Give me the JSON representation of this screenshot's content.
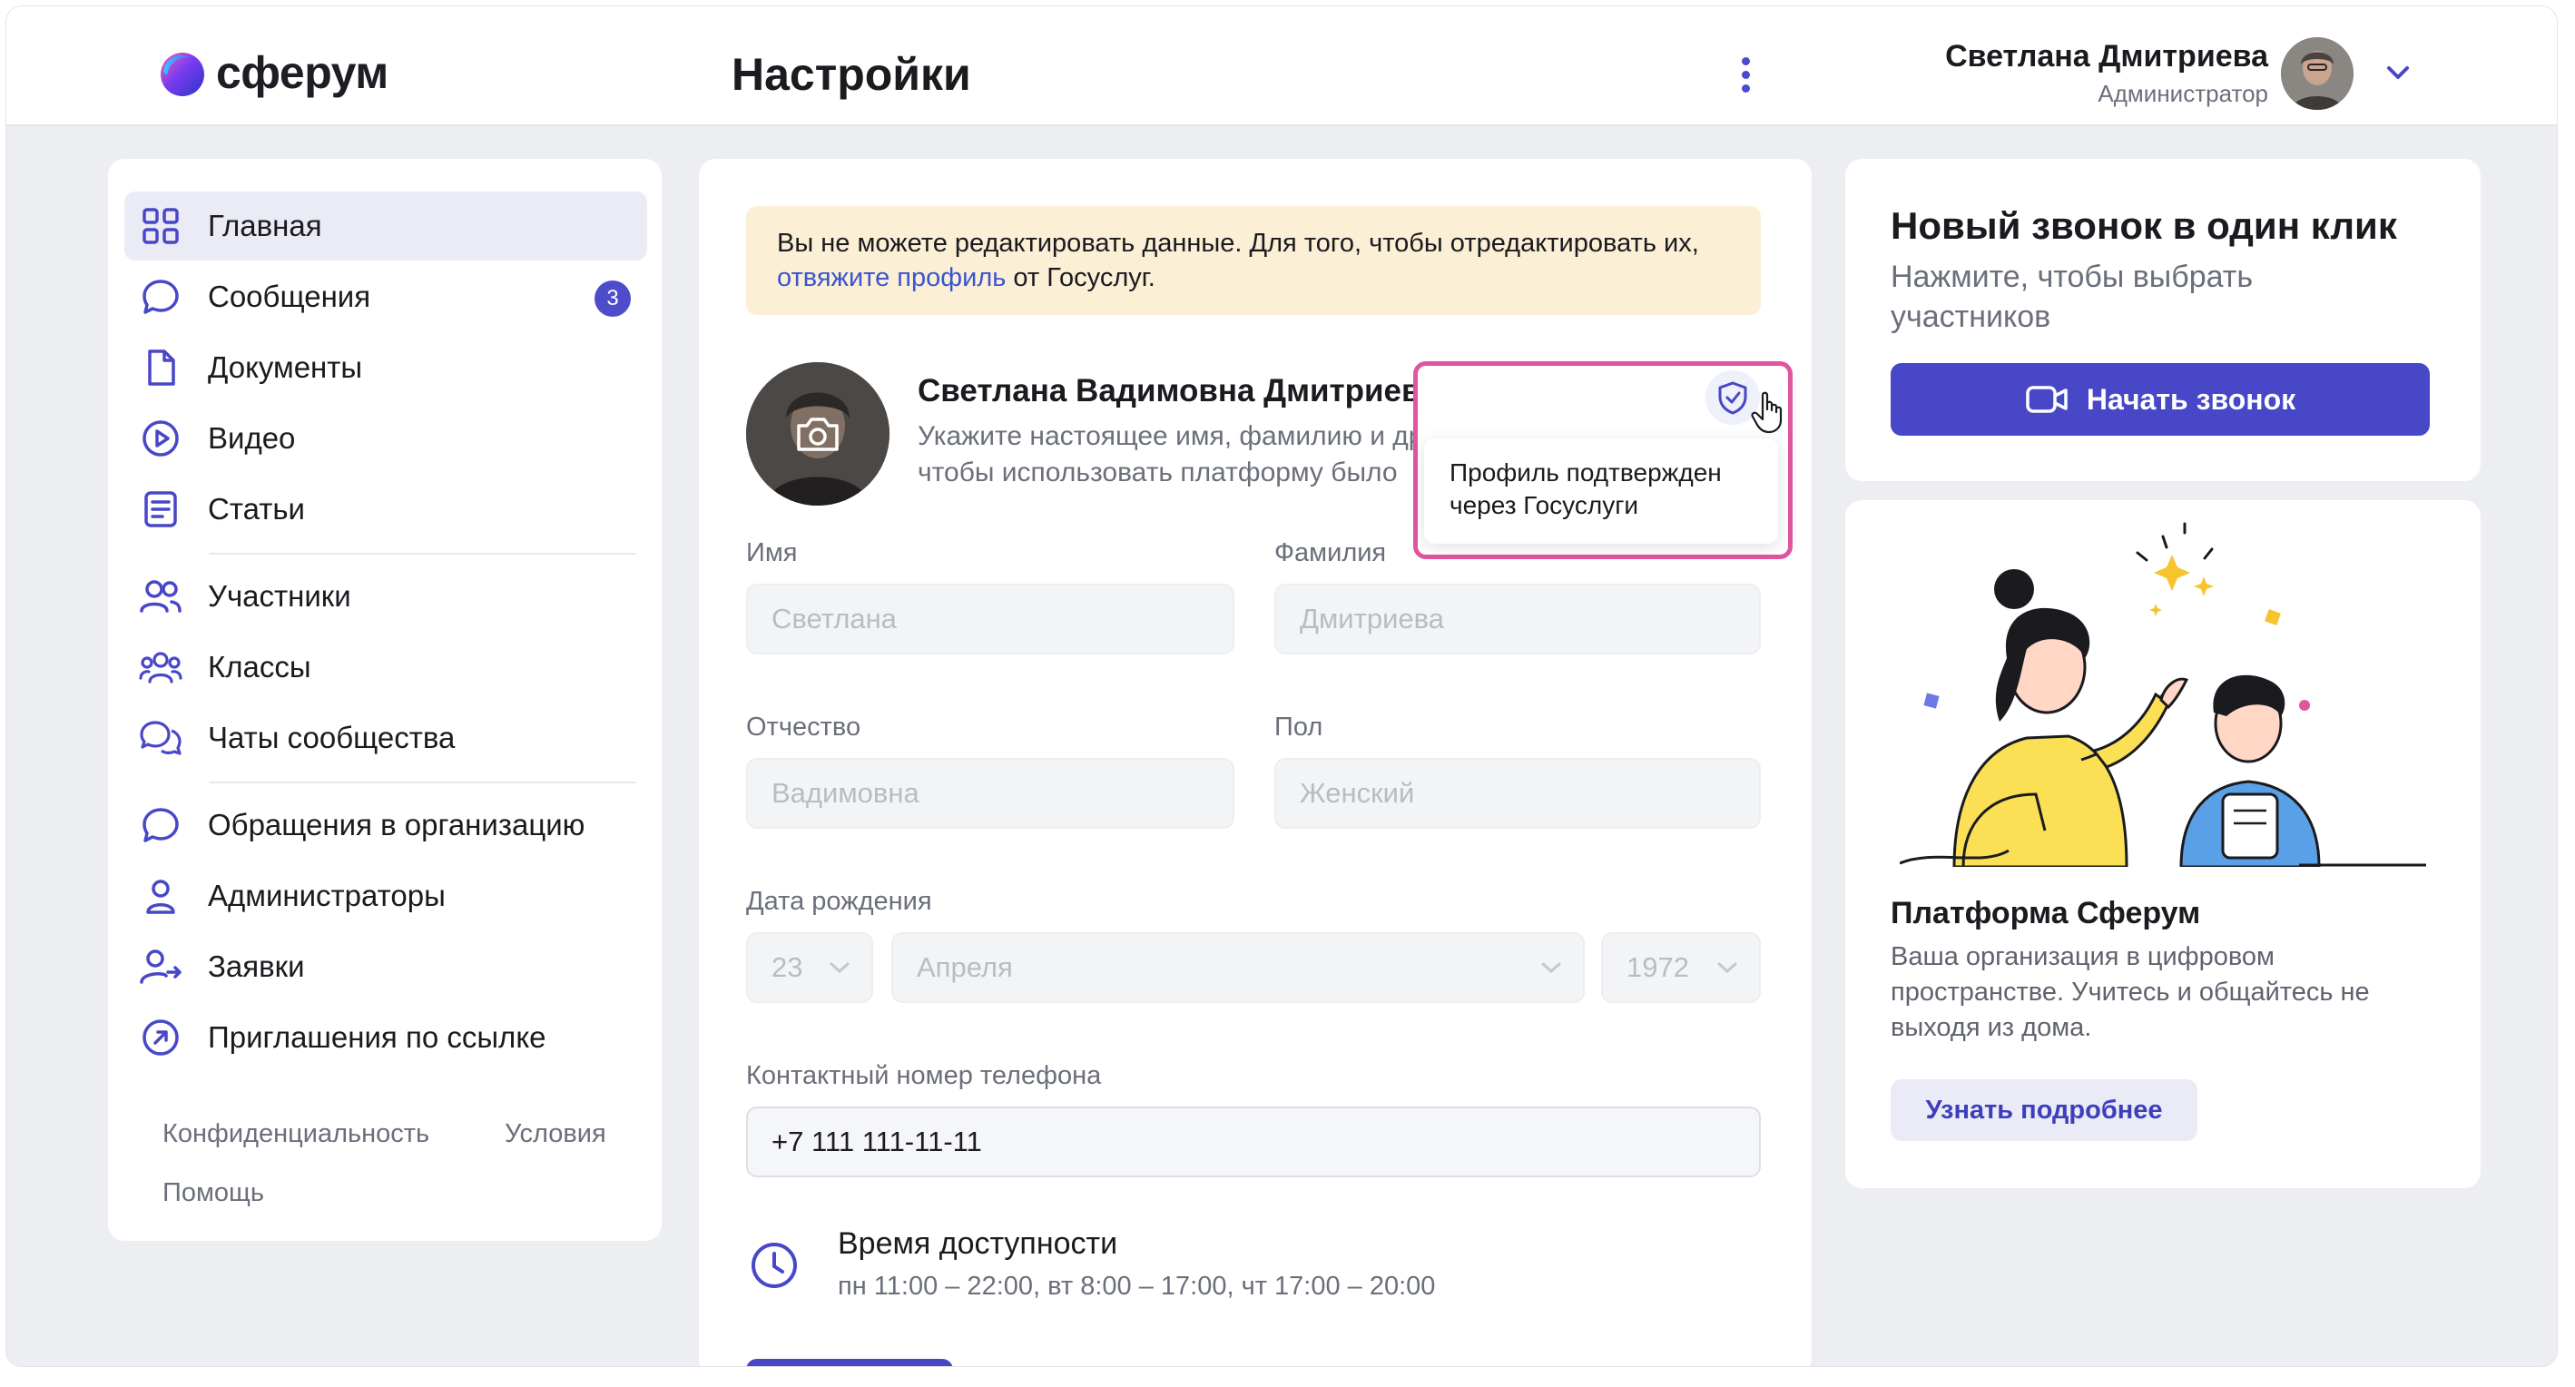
{
  "app": {
    "brand": "сферум",
    "page_title": "Настройки",
    "accent_color": "#4747c8"
  },
  "user": {
    "name": "Светлана Дмитриева",
    "role": "Администратор"
  },
  "sidebar": {
    "items": [
      {
        "label": "Главная",
        "icon": "grid-icon",
        "active": true
      },
      {
        "label": "Сообщения",
        "icon": "chat-bubble-icon",
        "badge": "3"
      },
      {
        "label": "Документы",
        "icon": "document-icon"
      },
      {
        "label": "Видео",
        "icon": "play-circle-icon"
      },
      {
        "label": "Статьи",
        "icon": "article-icon"
      },
      {
        "label": "Участники",
        "icon": "users-icon"
      },
      {
        "label": "Классы",
        "icon": "group-icon"
      },
      {
        "label": "Чаты сообщества",
        "icon": "chats-icon"
      },
      {
        "label": "Обращения в организацию",
        "icon": "chat-bubble-icon"
      },
      {
        "label": "Администраторы",
        "icon": "user-icon"
      },
      {
        "label": "Заявки",
        "icon": "user-arrow-icon"
      },
      {
        "label": "Приглашения по ссылке",
        "icon": "link-arrow-icon"
      }
    ],
    "footer": {
      "privacy": "Конфиденциальность",
      "terms": "Условия",
      "help": "Помощь"
    }
  },
  "notice": {
    "text": "Вы не можете редактировать данные. Для того, чтобы отредактировать их,",
    "link": "отвяжите профиль",
    "suffix": " от Госуслуг."
  },
  "profile": {
    "full_name": "Светлана Вадимовна Дмитриева",
    "hint_line1": "Укажите настоящее имя, фамилию и другую информацию,",
    "hint_line2": "чтобы использовать платформу было"
  },
  "tooltip": {
    "text_line1": "Профиль подтвержден",
    "text_line2": "через Госуслуги"
  },
  "form": {
    "first_name_label": "Имя",
    "first_name_value": "Светлана",
    "last_name_label": "Фамилия",
    "last_name_value": "Дмитриева",
    "patronymic_label": "Отчество",
    "patronymic_value": "Вадимовна",
    "gender_label": "Пол",
    "gender_value": "Женский",
    "birth_label": "Дата рождения",
    "birth_day": "23",
    "birth_month": "Апреля",
    "birth_year": "1972",
    "phone_label": "Контактный номер телефона",
    "phone_value": "+7 111 111-11-11"
  },
  "availability": {
    "title": "Время доступности",
    "schedule": "пн 11:00 – 22:00, вт 8:00 – 17:00, чт 17:00 – 20:00"
  },
  "call_card": {
    "title": "Новый звонок в один клик",
    "subtitle": "Нажмите, чтобы выбрать участников",
    "button": "Начать звонок"
  },
  "promo_card": {
    "title": "Платформа Сферум",
    "text": "Ваша организация в цифровом пространстве. Учитесь и общайтесь не выходя из дома.",
    "button": "Узнать подробнее"
  }
}
